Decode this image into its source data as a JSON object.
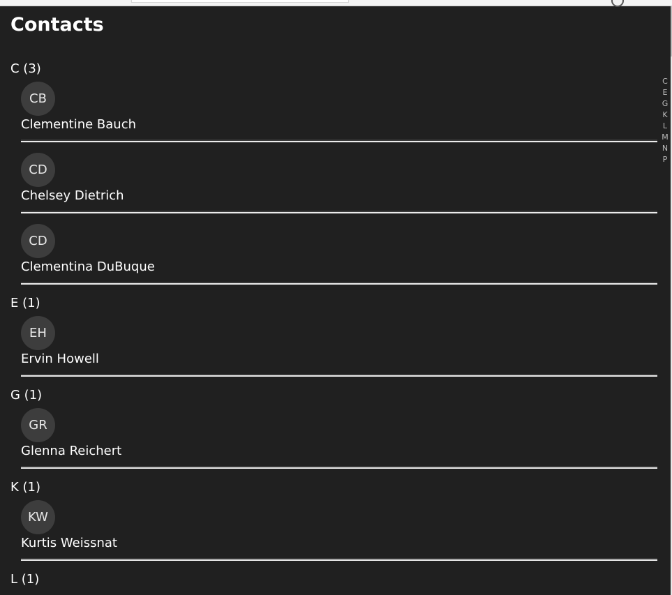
{
  "page": {
    "title": "Contacts"
  },
  "index_letters": [
    "C",
    "E",
    "G",
    "K",
    "L",
    "M",
    "N",
    "P"
  ],
  "groups": [
    {
      "header": "C (3)",
      "contacts": [
        {
          "initials": "CB",
          "name": "Clementine Bauch"
        },
        {
          "initials": "CD",
          "name": "Chelsey Dietrich"
        },
        {
          "initials": "CD",
          "name": "Clementina DuBuque"
        }
      ]
    },
    {
      "header": "E (1)",
      "contacts": [
        {
          "initials": "EH",
          "name": "Ervin Howell"
        }
      ]
    },
    {
      "header": "G (1)",
      "contacts": [
        {
          "initials": "GR",
          "name": "Glenna Reichert"
        }
      ]
    },
    {
      "header": "K (1)",
      "contacts": [
        {
          "initials": "KW",
          "name": "Kurtis Weissnat"
        }
      ]
    },
    {
      "header": "L (1)",
      "contacts": []
    }
  ]
}
